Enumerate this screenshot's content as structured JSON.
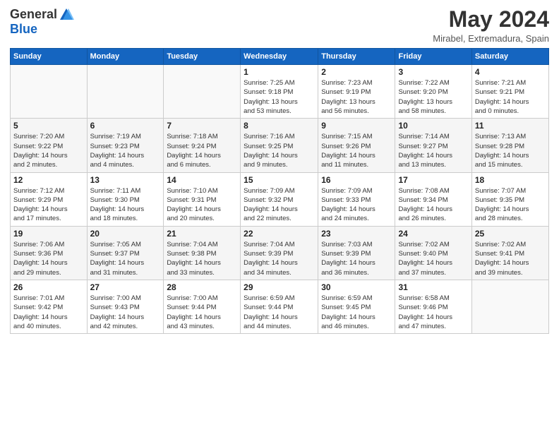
{
  "header": {
    "logo_general": "General",
    "logo_blue": "Blue",
    "month_year": "May 2024",
    "location": "Mirabel, Extremadura, Spain"
  },
  "days_of_week": [
    "Sunday",
    "Monday",
    "Tuesday",
    "Wednesday",
    "Thursday",
    "Friday",
    "Saturday"
  ],
  "weeks": [
    [
      {
        "day": "",
        "info": ""
      },
      {
        "day": "",
        "info": ""
      },
      {
        "day": "",
        "info": ""
      },
      {
        "day": "1",
        "info": "Sunrise: 7:25 AM\nSunset: 9:18 PM\nDaylight: 13 hours\nand 53 minutes."
      },
      {
        "day": "2",
        "info": "Sunrise: 7:23 AM\nSunset: 9:19 PM\nDaylight: 13 hours\nand 56 minutes."
      },
      {
        "day": "3",
        "info": "Sunrise: 7:22 AM\nSunset: 9:20 PM\nDaylight: 13 hours\nand 58 minutes."
      },
      {
        "day": "4",
        "info": "Sunrise: 7:21 AM\nSunset: 9:21 PM\nDaylight: 14 hours\nand 0 minutes."
      }
    ],
    [
      {
        "day": "5",
        "info": "Sunrise: 7:20 AM\nSunset: 9:22 PM\nDaylight: 14 hours\nand 2 minutes."
      },
      {
        "day": "6",
        "info": "Sunrise: 7:19 AM\nSunset: 9:23 PM\nDaylight: 14 hours\nand 4 minutes."
      },
      {
        "day": "7",
        "info": "Sunrise: 7:18 AM\nSunset: 9:24 PM\nDaylight: 14 hours\nand 6 minutes."
      },
      {
        "day": "8",
        "info": "Sunrise: 7:16 AM\nSunset: 9:25 PM\nDaylight: 14 hours\nand 9 minutes."
      },
      {
        "day": "9",
        "info": "Sunrise: 7:15 AM\nSunset: 9:26 PM\nDaylight: 14 hours\nand 11 minutes."
      },
      {
        "day": "10",
        "info": "Sunrise: 7:14 AM\nSunset: 9:27 PM\nDaylight: 14 hours\nand 13 minutes."
      },
      {
        "day": "11",
        "info": "Sunrise: 7:13 AM\nSunset: 9:28 PM\nDaylight: 14 hours\nand 15 minutes."
      }
    ],
    [
      {
        "day": "12",
        "info": "Sunrise: 7:12 AM\nSunset: 9:29 PM\nDaylight: 14 hours\nand 17 minutes."
      },
      {
        "day": "13",
        "info": "Sunrise: 7:11 AM\nSunset: 9:30 PM\nDaylight: 14 hours\nand 18 minutes."
      },
      {
        "day": "14",
        "info": "Sunrise: 7:10 AM\nSunset: 9:31 PM\nDaylight: 14 hours\nand 20 minutes."
      },
      {
        "day": "15",
        "info": "Sunrise: 7:09 AM\nSunset: 9:32 PM\nDaylight: 14 hours\nand 22 minutes."
      },
      {
        "day": "16",
        "info": "Sunrise: 7:09 AM\nSunset: 9:33 PM\nDaylight: 14 hours\nand 24 minutes."
      },
      {
        "day": "17",
        "info": "Sunrise: 7:08 AM\nSunset: 9:34 PM\nDaylight: 14 hours\nand 26 minutes."
      },
      {
        "day": "18",
        "info": "Sunrise: 7:07 AM\nSunset: 9:35 PM\nDaylight: 14 hours\nand 28 minutes."
      }
    ],
    [
      {
        "day": "19",
        "info": "Sunrise: 7:06 AM\nSunset: 9:36 PM\nDaylight: 14 hours\nand 29 minutes."
      },
      {
        "day": "20",
        "info": "Sunrise: 7:05 AM\nSunset: 9:37 PM\nDaylight: 14 hours\nand 31 minutes."
      },
      {
        "day": "21",
        "info": "Sunrise: 7:04 AM\nSunset: 9:38 PM\nDaylight: 14 hours\nand 33 minutes."
      },
      {
        "day": "22",
        "info": "Sunrise: 7:04 AM\nSunset: 9:39 PM\nDaylight: 14 hours\nand 34 minutes."
      },
      {
        "day": "23",
        "info": "Sunrise: 7:03 AM\nSunset: 9:39 PM\nDaylight: 14 hours\nand 36 minutes."
      },
      {
        "day": "24",
        "info": "Sunrise: 7:02 AM\nSunset: 9:40 PM\nDaylight: 14 hours\nand 37 minutes."
      },
      {
        "day": "25",
        "info": "Sunrise: 7:02 AM\nSunset: 9:41 PM\nDaylight: 14 hours\nand 39 minutes."
      }
    ],
    [
      {
        "day": "26",
        "info": "Sunrise: 7:01 AM\nSunset: 9:42 PM\nDaylight: 14 hours\nand 40 minutes."
      },
      {
        "day": "27",
        "info": "Sunrise: 7:00 AM\nSunset: 9:43 PM\nDaylight: 14 hours\nand 42 minutes."
      },
      {
        "day": "28",
        "info": "Sunrise: 7:00 AM\nSunset: 9:44 PM\nDaylight: 14 hours\nand 43 minutes."
      },
      {
        "day": "29",
        "info": "Sunrise: 6:59 AM\nSunset: 9:44 PM\nDaylight: 14 hours\nand 44 minutes."
      },
      {
        "day": "30",
        "info": "Sunrise: 6:59 AM\nSunset: 9:45 PM\nDaylight: 14 hours\nand 46 minutes."
      },
      {
        "day": "31",
        "info": "Sunrise: 6:58 AM\nSunset: 9:46 PM\nDaylight: 14 hours\nand 47 minutes."
      },
      {
        "day": "",
        "info": ""
      }
    ]
  ]
}
